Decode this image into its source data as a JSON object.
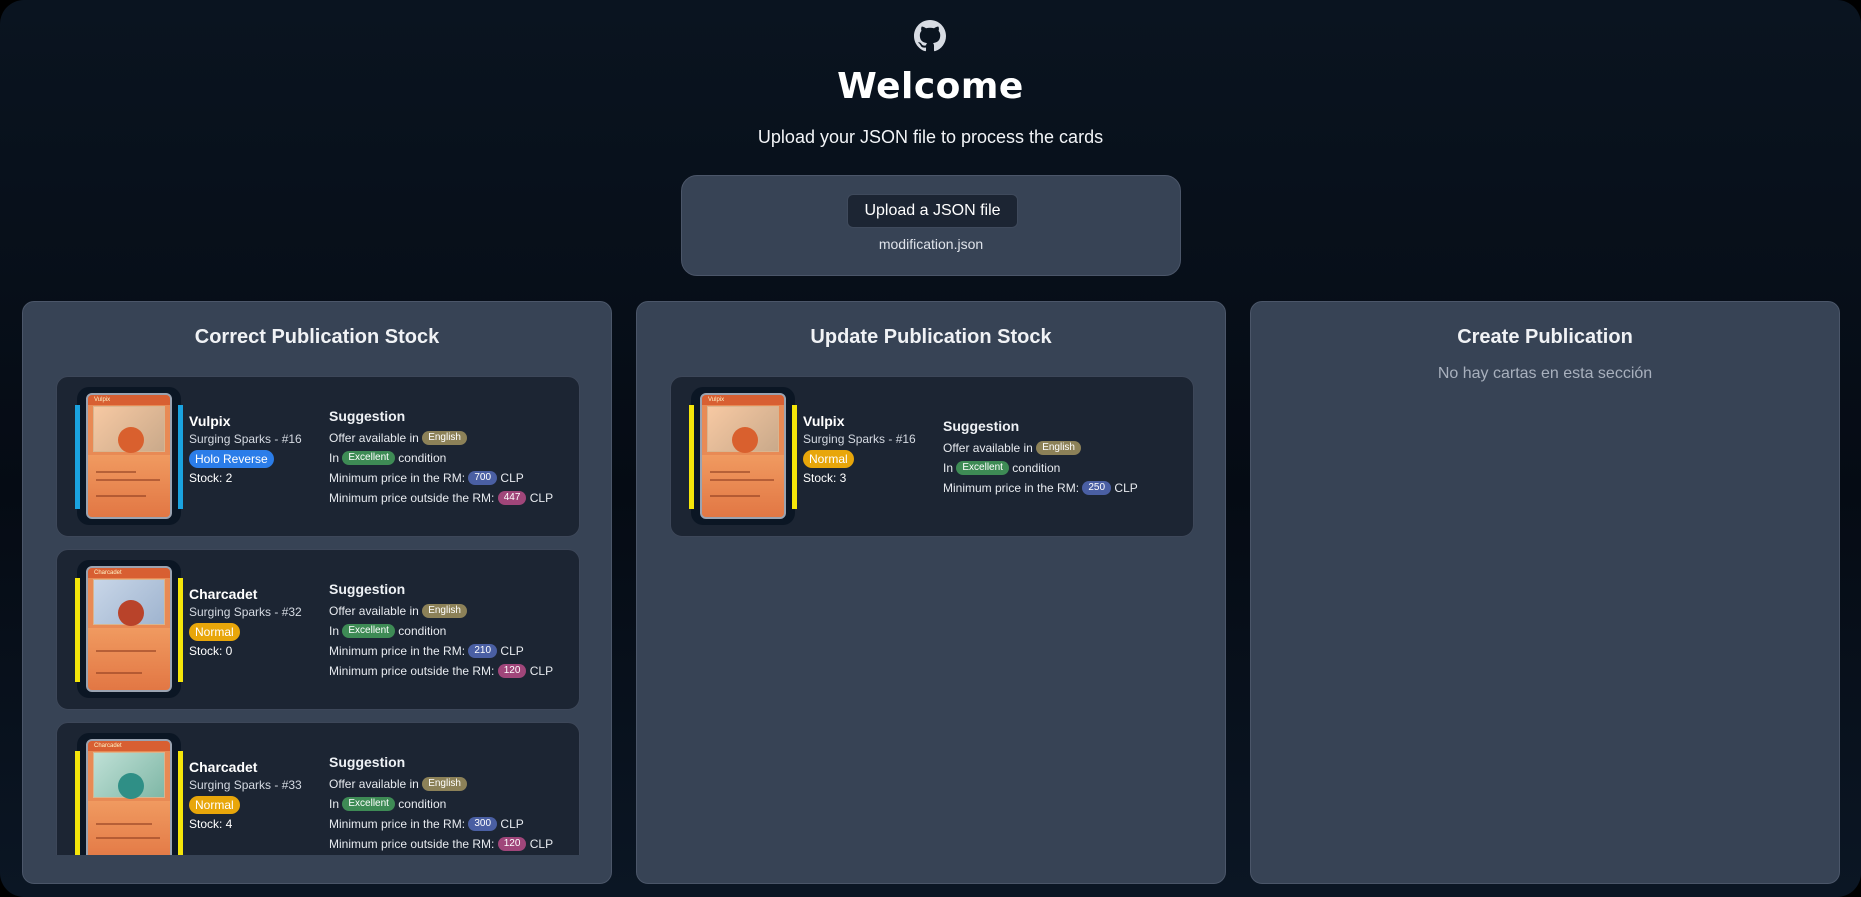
{
  "header": {
    "icon": "github-icon",
    "title": "Welcome",
    "subtitle": "Upload your JSON file to process the cards"
  },
  "upload": {
    "button_label": "Upload a JSON file",
    "file_name": "modification.json"
  },
  "labels": {
    "suggestion": "Suggestion",
    "offer_prefix": "Offer available in",
    "condition_prefix": "In",
    "condition_suffix": "condition",
    "min_rm": "Minimum price in the RM:",
    "min_outside": "Minimum price outside the RM:",
    "currency": "CLP"
  },
  "panels": [
    {
      "title": "Correct Publication Stock",
      "cards": [
        {
          "name": "Vulpix",
          "set": "Surging Sparks - #16",
          "variant": "Holo Reverse",
          "stock": "Stock: 2",
          "stripe_color": "#1aa3e0",
          "card_header": "Vulpix",
          "card_hp": "70",
          "language": "English",
          "condition": "Excellent",
          "min_rm": "700",
          "min_outside": "447"
        },
        {
          "name": "Charcadet",
          "set": "Surging Sparks - #32",
          "variant": "Normal",
          "stock": "Stock: 0",
          "stripe_color": "#f5e60a",
          "card_header": "Charcadet",
          "card_hp": "70",
          "language": "English",
          "condition": "Excellent",
          "min_rm": "210",
          "min_outside": "120"
        },
        {
          "name": "Charcadet",
          "set": "Surging Sparks - #33",
          "variant": "Normal",
          "stock": "Stock: 4",
          "stripe_color": "#f5e60a",
          "card_header": "Charcadet",
          "card_hp": "80",
          "language": "English",
          "condition": "Excellent",
          "min_rm": "300",
          "min_outside": "120"
        }
      ]
    },
    {
      "title": "Update Publication Stock",
      "cards": [
        {
          "name": "Vulpix",
          "set": "Surging Sparks - #16",
          "variant": "Normal",
          "stock": "Stock: 3",
          "stripe_color": "#f5e60a",
          "card_header": "Vulpix",
          "card_hp": "70",
          "language": "English",
          "condition": "Excellent",
          "min_rm": "250"
        }
      ]
    },
    {
      "title": "Create Publication",
      "empty_text": "No hay cartas en esta sección"
    }
  ]
}
